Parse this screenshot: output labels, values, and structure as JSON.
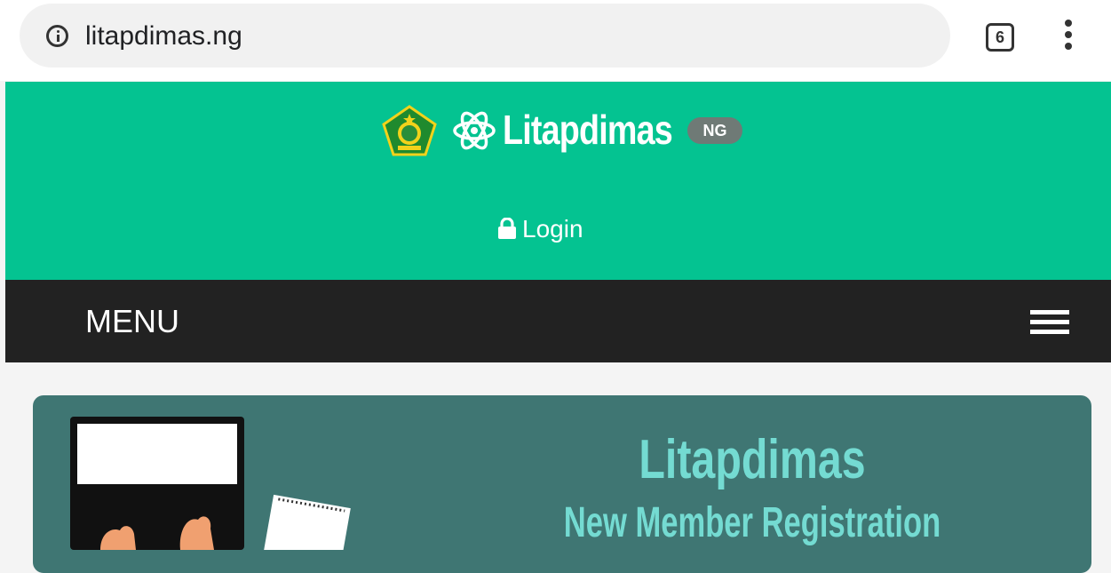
{
  "browser": {
    "url": "litapdimas.ng",
    "tab_count": "6"
  },
  "header": {
    "brand_name": "Litapdimas",
    "brand_badge": "NG",
    "login_label": "Login"
  },
  "menu": {
    "label": "MENU"
  },
  "banner": {
    "title": "Litapdimas",
    "subtitle": "New Member Registration"
  },
  "icons": {
    "info": "info-icon",
    "tabs": "tab-switcher-icon",
    "overflow": "kebab-menu-icon",
    "emblem": "ministry-emblem-icon",
    "atom": "atom-icon",
    "lock": "lock-icon",
    "hamburger": "hamburger-icon"
  },
  "colors": {
    "header_green": "#04c391",
    "menu_dark": "#222222",
    "banner_teal": "#3f7673",
    "banner_text": "#74dbd2",
    "badge_gray": "#6f7a76"
  }
}
